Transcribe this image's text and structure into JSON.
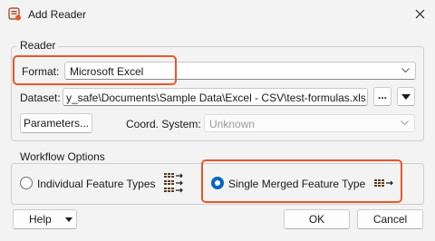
{
  "window": {
    "title": "Add Reader"
  },
  "reader_group": {
    "legend": "Reader"
  },
  "format": {
    "label": "Format:",
    "value": "Microsoft Excel"
  },
  "dataset": {
    "label": "Dataset:",
    "value": "y_safe\\Documents\\Sample Data\\Excel - CSV\\test-formulas.xlsx\"",
    "browse_label": "..."
  },
  "parameters": {
    "button_label": "Parameters..."
  },
  "coord_system": {
    "label": "Coord. System:",
    "value": "Unknown"
  },
  "workflow_group": {
    "legend": "Workflow Options"
  },
  "workflow_options": [
    {
      "label": "Individual Feature Types",
      "selected": false,
      "icon": "multiple-feature-types-icon"
    },
    {
      "label": "Single Merged Feature Type",
      "selected": true,
      "icon": "merged-feature-type-icon"
    }
  ],
  "footer": {
    "help_label": "Help",
    "ok_label": "OK",
    "cancel_label": "Cancel"
  },
  "colors": {
    "highlight": "#e8562a",
    "accent": "#0067c0"
  }
}
